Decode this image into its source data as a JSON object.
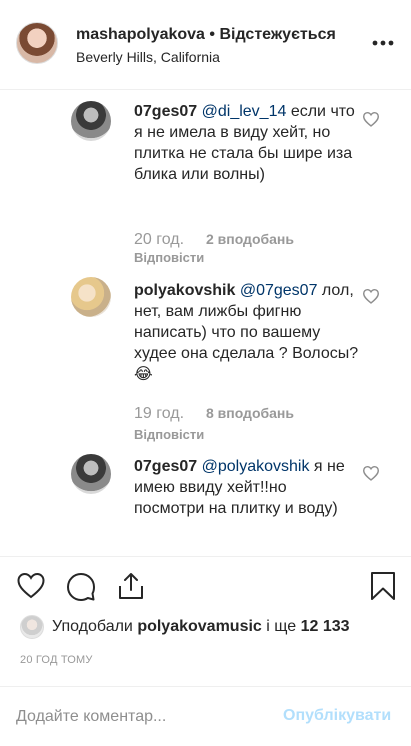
{
  "header": {
    "username": "mashapolyakova",
    "separator": "•",
    "follow_state": "Відстежується",
    "location": "Beverly Hills, California",
    "more_icon": "more-horizontal-icon"
  },
  "comments": [
    {
      "username": "07ges07",
      "mention": "@di_lev_14",
      "body": " если что я не имела в виду хейт, но плитка не стала бы шире иза блика или волны)",
      "time": "20 год.",
      "likes": "2 вподобань",
      "reply": "Відповісти"
    },
    {
      "username": "polyakovshik",
      "mention": "@07ges07",
      "body": " лол, нет, вам лижбы фигню написать) что по вашему худее она сделала ? Волосы? 😂",
      "time": "19 год.",
      "likes": "8 вподобань",
      "reply": "Відповісти"
    },
    {
      "username": "07ges07",
      "mention": "@polyakovshik",
      "body": " я не имею ввиду хейт!!но посмотри на плитку и воду)",
      "time": "",
      "likes": "",
      "reply": ""
    }
  ],
  "likes": {
    "prefix": "Уподобали",
    "user": "polyakovamusic",
    "middle": "і ще",
    "count": "12 133"
  },
  "posted_time": "20 ГОД ТОМУ",
  "add_comment": {
    "placeholder": "Додайте коментар...",
    "publish_label": "Опублікувати"
  },
  "colors": {
    "text": "#262626",
    "muted": "#999999",
    "mention": "#003569",
    "publish_disabled": "#b2dffc",
    "divider": "#efefef"
  }
}
